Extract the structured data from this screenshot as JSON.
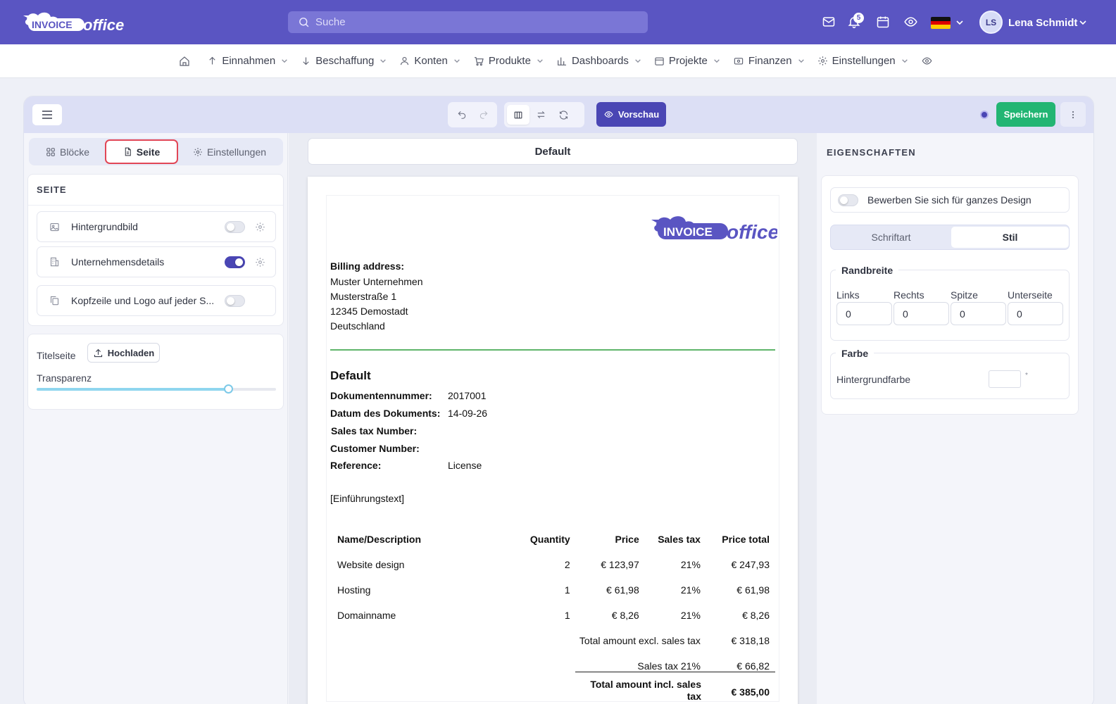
{
  "topbar": {
    "search_placeholder": "Suche",
    "notification_count": "5",
    "user_initials": "LS",
    "user_name": "Lena Schmidt",
    "accent": "#5a55c2"
  },
  "nav": {
    "items": [
      {
        "label": "Einnahmen"
      },
      {
        "label": "Beschaffung"
      },
      {
        "label": "Konten"
      },
      {
        "label": "Produkte"
      },
      {
        "label": "Dashboards"
      },
      {
        "label": "Projekte"
      },
      {
        "label": "Finanzen"
      },
      {
        "label": "Einstellungen"
      }
    ]
  },
  "toolbar": {
    "preview_label": "Vorschau",
    "save_label": "Speichern"
  },
  "left": {
    "tabs": [
      {
        "label": "Blöcke"
      },
      {
        "label": "Seite"
      },
      {
        "label": "Einstellungen"
      }
    ],
    "section_title": "SEITE",
    "options": [
      {
        "label": "Hintergrundbild",
        "enabled": false
      },
      {
        "label": "Unternehmensdetails",
        "enabled": true
      },
      {
        "label": "Kopfzeile und Logo auf jeder S...",
        "enabled": false
      }
    ],
    "title_page_label": "Titelseite",
    "upload_label": "Hochladen",
    "transparency_label": "Transparenz",
    "transparency_value": 0.8
  },
  "center": {
    "template_name": "Default",
    "document": {
      "billing_label": "Billing address:",
      "address": [
        "Muster Unternehmen",
        "Musterstraße 1",
        "12345 Demostadt",
        "Deutschland"
      ],
      "doc_title": "Default",
      "meta": [
        {
          "label": "Dokumentennummer:",
          "value": "2017001"
        },
        {
          "label": "Datum des Dokuments:",
          "value": "14-09-26"
        },
        {
          "label": "Sales tax Number:",
          "value": ""
        },
        {
          "label": "Customer Number:",
          "value": ""
        },
        {
          "label": "Reference:",
          "value": "License"
        }
      ],
      "intro": "[Einführungstext]",
      "table": {
        "headers": [
          "Name/Description",
          "Quantity",
          "Price",
          "Sales tax",
          "Price total"
        ],
        "rows": [
          [
            "Website design",
            "2",
            "€ 123,97",
            "21%",
            "€ 247,93"
          ],
          [
            "Hosting",
            "1",
            "€ 61,98",
            "21%",
            "€ 61,98"
          ],
          [
            "Domainname",
            "1",
            "€ 8,26",
            "21%",
            "€ 8,26"
          ]
        ]
      },
      "totals": [
        {
          "label": "Total amount excl. sales tax",
          "value": "€ 318,18"
        },
        {
          "label": "Sales tax 21%",
          "value": "€ 66,82"
        },
        {
          "label": "Total amount incl. sales tax",
          "value": "€ 385,00"
        }
      ],
      "divider_color": "#5fb56a"
    }
  },
  "right": {
    "title": "EIGENSCHAFTEN",
    "apply_label": "Bewerben Sie sich für ganzes Design",
    "seg_tabs": [
      "Schriftart",
      "Stil"
    ],
    "margin_legend": "Randbreite",
    "margins": [
      {
        "label": "Links",
        "value": "0"
      },
      {
        "label": "Rechts",
        "value": "0"
      },
      {
        "label": "Spitze",
        "value": "0"
      },
      {
        "label": "Unterseite",
        "value": "0"
      }
    ],
    "color_legend": "Farbe",
    "bg_color_label": "Hintergrundfarbe",
    "required_mark": "*"
  }
}
